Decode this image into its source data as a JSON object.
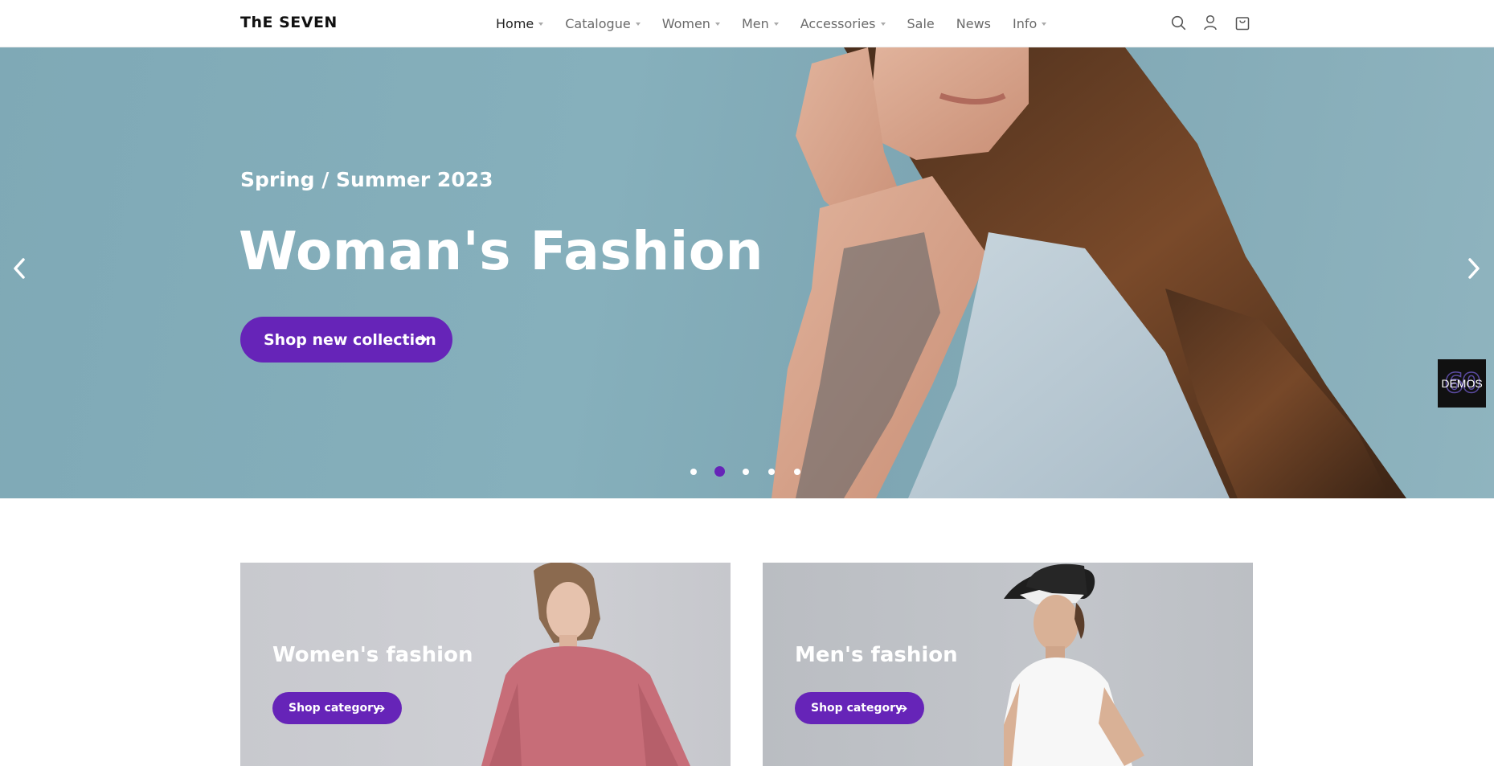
{
  "brand": {
    "logo": "ThE SEVEN"
  },
  "nav": [
    {
      "label": "Home",
      "caret": true,
      "active": true
    },
    {
      "label": "Catalogue",
      "caret": true
    },
    {
      "label": "Women",
      "caret": true
    },
    {
      "label": "Men",
      "caret": true
    },
    {
      "label": "Accessories",
      "caret": true
    },
    {
      "label": "Sale",
      "caret": false
    },
    {
      "label": "News",
      "caret": false
    },
    {
      "label": "Info",
      "caret": true
    }
  ],
  "header_icons": [
    "search-icon",
    "user-icon",
    "cart-icon"
  ],
  "hero": {
    "subtitle": "Spring / Summer 2023",
    "title": "Woman's Fashion",
    "button_label": "Shop new collection",
    "slide_count": 5,
    "active_slide": 2
  },
  "demos_badge": {
    "label": "DEMOS",
    "number": "60"
  },
  "categories": [
    {
      "title": "Women's fashion",
      "button_label": "Shop category"
    },
    {
      "title": "Men's fashion",
      "button_label": "Shop category"
    }
  ],
  "colors": {
    "accent": "#6624b8",
    "hero_bg": "#82abb8",
    "text": "#222222"
  }
}
